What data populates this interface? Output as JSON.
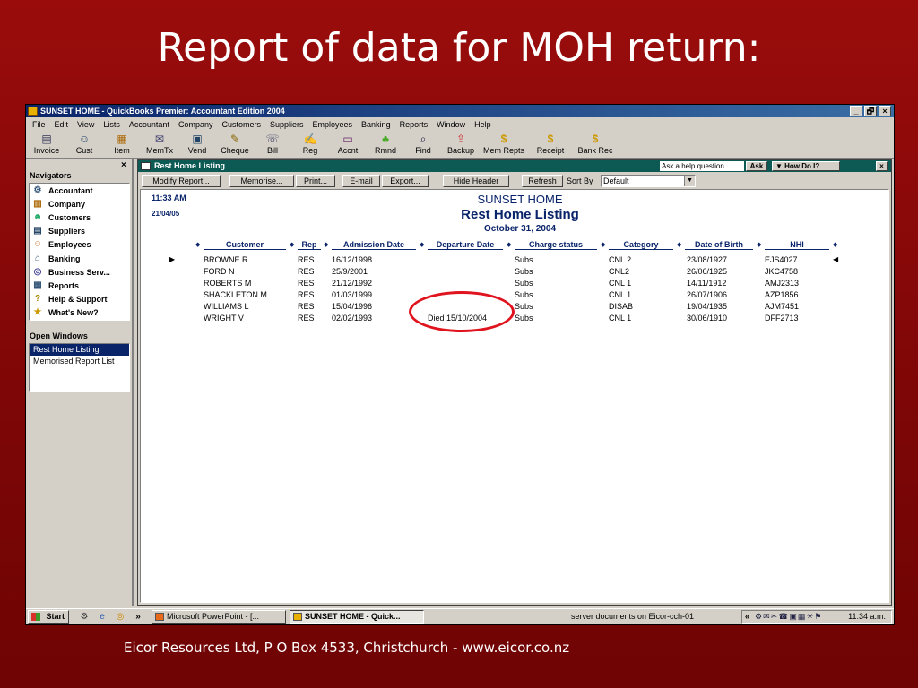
{
  "slide": {
    "title": "Report of data for MOH return:",
    "footer": "Eicor Resources Ltd, P O Box 4533, Christchurch -  www.eicor.co.nz"
  },
  "app": {
    "title": "SUNSET HOME - QuickBooks Premier: Accountant Edition 2004",
    "win_buttons": [
      "_",
      "🗗",
      "×"
    ]
  },
  "menu": [
    "File",
    "Edit",
    "View",
    "Lists",
    "Accountant",
    "Company",
    "Customers",
    "Suppliers",
    "Employees",
    "Banking",
    "Reports",
    "Window",
    "Help"
  ],
  "toolbar": [
    {
      "label": "Invoice",
      "icon": "invoice-icon",
      "glyph": "▤"
    },
    {
      "label": "Cust",
      "icon": "customer-icon",
      "glyph": "☺"
    },
    {
      "label": "Item",
      "icon": "item-icon",
      "glyph": "▦"
    },
    {
      "label": "MemTx",
      "icon": "memorized-transactions-icon",
      "glyph": "✉"
    },
    {
      "label": "Vend",
      "icon": "vendor-icon",
      "glyph": "▣"
    },
    {
      "label": "Cheque",
      "icon": "cheque-icon",
      "glyph": "✎"
    },
    {
      "label": "Bill",
      "icon": "bill-icon",
      "glyph": "☏"
    },
    {
      "label": "Reg",
      "icon": "register-icon",
      "glyph": "✍"
    },
    {
      "label": "Accnt",
      "icon": "account-icon",
      "glyph": "▭"
    },
    {
      "label": "Rmnd",
      "icon": "reminders-icon",
      "glyph": "♣"
    },
    {
      "label": "Find",
      "icon": "find-icon",
      "glyph": "⌕"
    },
    {
      "label": "Backup",
      "icon": "backup-icon",
      "glyph": "⇪"
    },
    {
      "label": "Mem Repts",
      "icon": "memorized-reports-icon",
      "glyph": "$"
    },
    {
      "label": "Receipt",
      "icon": "receipt-icon",
      "glyph": "$"
    },
    {
      "label": "Bank Rec",
      "icon": "bank-reconcile-icon",
      "glyph": "$"
    }
  ],
  "navigators": {
    "header": "Navigators",
    "close": "×",
    "items": [
      {
        "label": "Accountant",
        "icon": "accountant-icon",
        "glyph": "⚙"
      },
      {
        "label": "Company",
        "icon": "company-icon",
        "glyph": "▥"
      },
      {
        "label": "Customers",
        "icon": "customers-icon",
        "glyph": "☻"
      },
      {
        "label": "Suppliers",
        "icon": "suppliers-icon",
        "glyph": "▤"
      },
      {
        "label": "Employees",
        "icon": "employees-icon",
        "glyph": "☺"
      },
      {
        "label": "Banking",
        "icon": "banking-icon",
        "glyph": "⌂"
      },
      {
        "label": "Business Serv...",
        "icon": "business-services-icon",
        "glyph": "◎"
      },
      {
        "label": "Reports",
        "icon": "reports-icon",
        "glyph": "▦"
      },
      {
        "label": "Help & Support",
        "icon": "help-icon",
        "glyph": "?"
      },
      {
        "label": "What's New?",
        "icon": "whats-new-icon",
        "glyph": "★"
      }
    ]
  },
  "open_windows": {
    "header": "Open Windows",
    "items": [
      "Rest Home Listing",
      "Memorised Report List"
    ]
  },
  "report_window": {
    "title": "Rest Home Listing",
    "help_placeholder": "Ask a help question",
    "ask_label": "Ask",
    "howdo_label": "▼ How Do I?",
    "close": "×",
    "buttons": {
      "modify": "Modify Report...",
      "memorise": "Memorise...",
      "print": "Print...",
      "email": "E-mail",
      "export": "Export...",
      "hide_header": "Hide Header",
      "refresh": "Refresh"
    },
    "sort_label": "Sort By",
    "sort_value": "Default"
  },
  "report": {
    "time": "11:33 AM",
    "date": "21/04/05",
    "company": "SUNSET HOME",
    "title": "Rest Home Listing",
    "period": "October 31, 2004",
    "columns": [
      "Customer",
      "Rep",
      "Admission Date",
      "Departure Date",
      "Charge status",
      "Category",
      "Date of Birth",
      "NHI"
    ],
    "rows": [
      [
        "BROWNE R",
        "RES",
        "16/12/1998",
        "",
        "Subs",
        "CNL 2",
        "23/08/1927",
        "EJS4027"
      ],
      [
        "FORD N",
        "RES",
        "25/9/2001",
        "",
        "Subs",
        "CNL2",
        "26/06/1925",
        "JKC4758"
      ],
      [
        "ROBERTS M",
        "RES",
        "21/12/1992",
        "",
        "Subs",
        "CNL 1",
        "14/11/1912",
        "AMJ2313"
      ],
      [
        "SHACKLETON M",
        "RES",
        "01/03/1999",
        "",
        "Subs",
        "CNL 1",
        "26/07/1906",
        "AZP1856"
      ],
      [
        "WILLIAMS L",
        "RES",
        "15/04/1996",
        "",
        "Subs",
        "DISAB",
        "19/04/1935",
        "AJM7451"
      ],
      [
        "WRIGHT V",
        "RES",
        "02/02/1993",
        "Died 15/10/2004",
        "Subs",
        "CNL 1",
        "30/06/1910",
        "DFF2713"
      ]
    ],
    "highlight_color": "#e0141e"
  },
  "taskbar": {
    "start": "Start",
    "chevron": "»",
    "tasks": [
      {
        "label": "Microsoft PowerPoint - [...",
        "icon": "powerpoint-icon"
      },
      {
        "label": "SUNSET HOME - Quick...",
        "icon": "quickbooks-icon"
      }
    ],
    "tray_text": "server documents on Eicor-cch-01",
    "tray_chevron": "«",
    "clock": "11:34 a.m."
  }
}
